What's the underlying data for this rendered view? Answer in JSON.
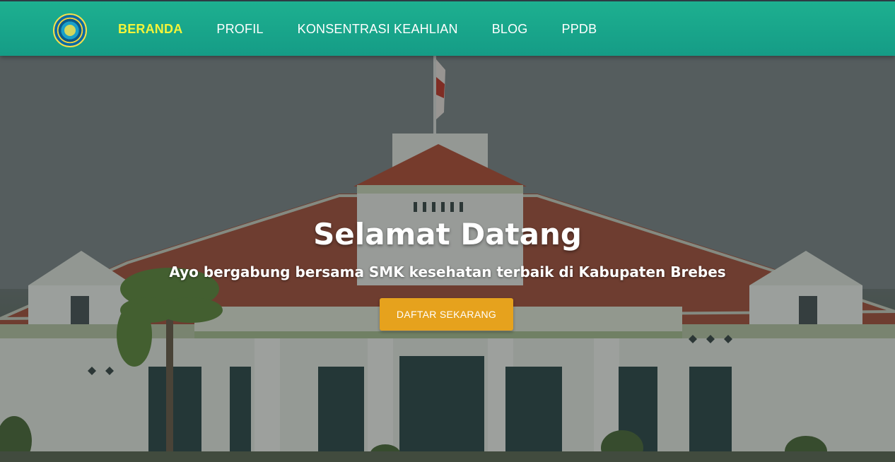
{
  "navbar": {
    "logo_icon": "school-emblem-icon",
    "links": [
      {
        "label": "BERANDA",
        "active": true
      },
      {
        "label": "PROFIL",
        "active": false
      },
      {
        "label": "KONSENTRASI KEAHLIAN",
        "active": false
      },
      {
        "label": "BLOG",
        "active": false
      },
      {
        "label": "PPDB",
        "active": false
      }
    ],
    "active_color": "#f4f43a",
    "bg_color": "#18a68a"
  },
  "hero": {
    "title": "Selamat Datang",
    "subtitle": "Ayo bergabung bersama SMK kesehatan terbaik di Kabupaten Brebes",
    "cta_label": "DAFTAR SEKARANG",
    "cta_color": "#e6a21d",
    "background_image": "school-building-photo"
  }
}
